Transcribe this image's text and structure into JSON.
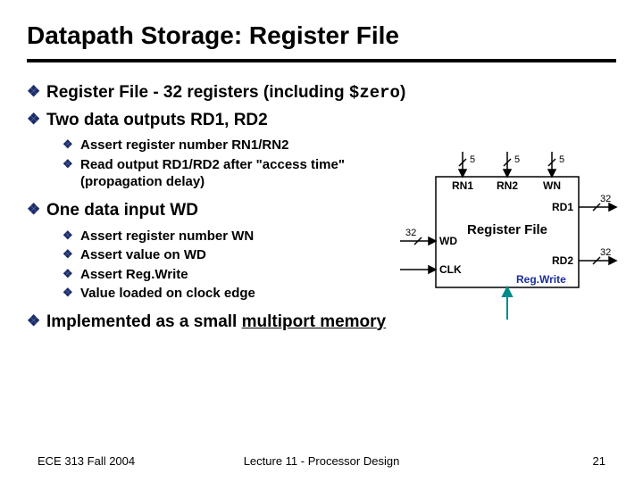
{
  "title": "Datapath Storage: Register File",
  "bullets": [
    {
      "prefix": "Register File - 32 registers (including ",
      "mono": "$zero",
      "suffix": ")"
    },
    {
      "text": "Two data outputs RD1, RD2"
    }
  ],
  "sublist1": [
    {
      "text": "Assert register number RN1/RN2"
    },
    {
      "text": "Read output RD1/RD2 after \"access time\" (propagation delay)"
    }
  ],
  "bullet3": "One data input WD",
  "sublist2": [
    {
      "text": "Assert register number WN"
    },
    {
      "text": "Assert value on WD"
    },
    {
      "text": "Assert Reg.Write"
    },
    {
      "text": "Value loaded on clock edge"
    }
  ],
  "bullet4": {
    "prefix": "Implemented as a small ",
    "underline": "multiport memory"
  },
  "diagram": {
    "box_label": "Register File",
    "ports": {
      "rn1": "RN1",
      "rn2": "RN2",
      "wn": "WN",
      "wd": "WD",
      "clk": "CLK",
      "rd1": "RD1",
      "rd2": "RD2",
      "regwrite": "Reg.Write"
    },
    "widths": {
      "addr": "5",
      "data": "32"
    }
  },
  "footer": {
    "left": "ECE 313 Fall 2004",
    "center": "Lecture 11 - Processor Design",
    "right": "21"
  }
}
